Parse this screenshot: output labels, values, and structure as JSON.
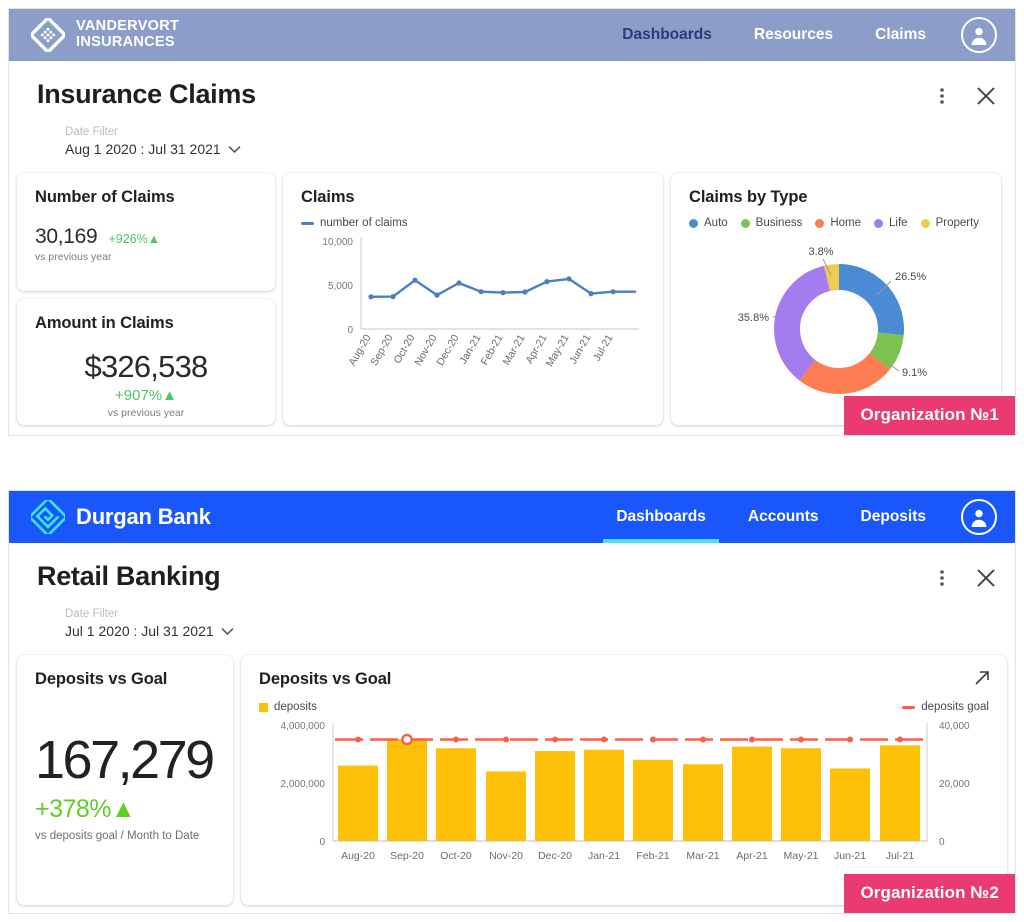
{
  "dashboards": [
    {
      "brand": {
        "name_line1": "VANDERVORT",
        "name_line2": "INSURANCES",
        "logo_icon": "diamond-dots-logo-icon",
        "header_color": "#8b9dc8"
      },
      "nav": [
        {
          "label": "Dashboards",
          "active": true
        },
        {
          "label": "Resources",
          "active": false
        },
        {
          "label": "Claims",
          "active": false
        }
      ],
      "avatar_icon": "user-avatar-icon",
      "title": "Insurance Claims",
      "actions": {
        "menu_icon": "kebab-menu-icon",
        "close_icon": "close-icon"
      },
      "date_filter": {
        "label": "Date Filter",
        "value": "Aug 1 2020 : Jul 31 2021",
        "chevron_icon": "chevron-down-icon"
      },
      "kpis": [
        {
          "title": "Number of Claims",
          "value": "30,169",
          "delta": "+926%▲",
          "sub": "vs previous year"
        },
        {
          "title": "Amount in Claims",
          "value": "$326,538",
          "delta": "+907%▲",
          "sub": "vs previous year"
        }
      ],
      "line_card": {
        "title": "Claims",
        "legend": [
          {
            "label": "number of claims",
            "color": "#4a7fc1"
          }
        ]
      },
      "donut_card": {
        "title": "Claims by Type",
        "legend": [
          {
            "label": "Auto",
            "color": "#4a8bd4"
          },
          {
            "label": "Business",
            "color": "#7dc14f"
          },
          {
            "label": "Home",
            "color": "#fc7d51"
          },
          {
            "label": "Life",
            "color": "#a57cf0"
          },
          {
            "label": "Property",
            "color": "#eccd4f"
          }
        ]
      },
      "badge": "Organization №1"
    },
    {
      "brand": {
        "name_line1": "Durgan Bank",
        "name_line2": "",
        "logo_icon": "diamond-spiral-logo-icon",
        "header_color": "#1a57fa"
      },
      "nav": [
        {
          "label": "Dashboards",
          "active": true
        },
        {
          "label": "Accounts",
          "active": false
        },
        {
          "label": "Deposits",
          "active": false
        }
      ],
      "avatar_icon": "user-avatar-icon",
      "title": "Retail Banking",
      "actions": {
        "menu_icon": "kebab-menu-icon",
        "close_icon": "close-icon"
      },
      "date_filter": {
        "label": "Date Filter",
        "value": "Jul 1 2020 : Jul 31 2021",
        "chevron_icon": "chevron-down-icon"
      },
      "kpis": [
        {
          "title": "Deposits vs Goal",
          "value": "167,279",
          "delta": "+378%▲",
          "sub": "vs deposits goal / Month to Date"
        }
      ],
      "bar_card": {
        "title": "Deposits vs Goal",
        "expand_icon": "expand-arrow-icon",
        "legend_left": {
          "label": "deposits",
          "color": "#fec107"
        },
        "legend_right": {
          "label": "deposits goal",
          "color": "#f9604a"
        }
      },
      "badge": "Organization №2"
    }
  ],
  "chart_data": [
    {
      "type": "line",
      "title": "Claims",
      "xlabel": "",
      "ylabel": "",
      "ylim": [
        0,
        10000
      ],
      "yticks": [
        "0",
        "5,000",
        "10,000"
      ],
      "grid": false,
      "legend_position": "top-left",
      "categories": [
        "Aug-20",
        "Sep-20",
        "Oct-20",
        "Nov-20",
        "Dec-20",
        "Jan-21",
        "Feb-21",
        "Mar-21",
        "Apr-21",
        "May-21",
        "Jun-21",
        "Jul-21"
      ],
      "series": [
        {
          "name": "number of claims",
          "color": "#4a7fc1",
          "values": [
            3500,
            3520,
            5300,
            3680,
            5000,
            4050,
            3950,
            4020,
            5150,
            5450,
            3850,
            4050
          ]
        }
      ]
    },
    {
      "type": "pie",
      "title": "Claims by Type",
      "legend_position": "top-left",
      "labels": [
        "Auto",
        "Business",
        "Home",
        "Life",
        "Property"
      ],
      "values": [
        26.5,
        9.1,
        24.8,
        35.8,
        3.8
      ],
      "value_labels": [
        "26.5%",
        "9.1%",
        "",
        "35.8%",
        "3.8%"
      ],
      "colors": [
        "#4a8bd4",
        "#7dc14f",
        "#fc7d51",
        "#a57cf0",
        "#eccd4f"
      ],
      "donut": true
    },
    {
      "type": "bar",
      "title": "Deposits vs Goal",
      "xlabel": "",
      "ylabel": "",
      "ylim": [
        0,
        4000000
      ],
      "yticks": [
        "0",
        "2,000,000",
        "4,000,000"
      ],
      "y2lim": [
        0,
        40000
      ],
      "y2ticks": [
        "0",
        "20,000",
        "40,000"
      ],
      "grid": false,
      "legend_position": "top",
      "categories": [
        "Aug-20",
        "Sep-20",
        "Oct-20",
        "Nov-20",
        "Dec-20",
        "Jan-21",
        "Feb-21",
        "Mar-21",
        "Apr-21",
        "May-21",
        "Jun-21",
        "Jul-21"
      ],
      "series": [
        {
          "name": "deposits",
          "type": "bar",
          "color": "#fec107",
          "axis": "left",
          "values": [
            2600000,
            3500000,
            3200000,
            2400000,
            3100000,
            3150000,
            2800000,
            2650000,
            3250000,
            3200000,
            2500000,
            3300000
          ]
        },
        {
          "name": "deposits goal",
          "type": "line",
          "color": "#f9604a",
          "axis": "right",
          "values": [
            35000,
            35000,
            35000,
            35000,
            35000,
            35000,
            35000,
            35000,
            35000,
            35000,
            35000,
            35000
          ]
        }
      ]
    }
  ]
}
